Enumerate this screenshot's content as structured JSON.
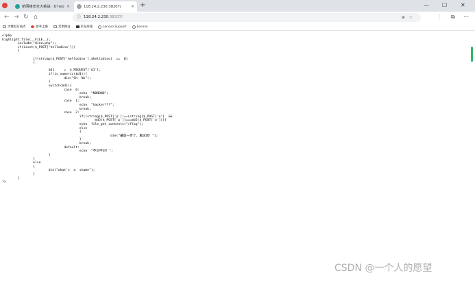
{
  "tabs": [
    {
      "label": "新网络安全大挑战 · D'neo CTF",
      "close": "×",
      "active": false,
      "favicon_color": "#1fa3a0"
    },
    {
      "label": "118.24.2.230:38207/",
      "close": "×",
      "active": true,
      "favicon_color": "#9aa0a6"
    }
  ],
  "new_tab": "+",
  "window_controls": {
    "minimize": "—",
    "maximize": "☐",
    "close": "✕"
  },
  "toolbar": {
    "back": "←",
    "forward": "→",
    "reload": "↻",
    "home": "⌂",
    "url_host": "118.24.2.230",
    "url_path": ":38207/",
    "omnibox_icons": "⊞☆",
    "split": "⫶",
    "extensions": "⧉",
    "menu": "⋯"
  },
  "bookmarks": [
    {
      "label": "大模拟方站点",
      "icon": "folder"
    },
    {
      "label": "新手上路",
      "icon": "red"
    },
    {
      "label": "常用网址",
      "icon": "folder"
    },
    {
      "label": "京东商城",
      "icon": "dark"
    },
    {
      "label": "Lenovo Support",
      "icon": "globe"
    },
    {
      "label": "Lenovo",
      "icon": "globe"
    }
  ],
  "code_lines": [
    "<?php",
    "highlight_file(__FILE__);",
    "        include(\"dino.php\");",
    "        if(isset($_POST['hellodino']))",
    "        {",
    "",
    "                if(strcmp($_POST['hellodino'],$hellodino)  ==  0)",
    "                {",
    "",
    "                        $d1     =  $_REQUEST['d1'];",
    "                        if(is_numeric($d1)){",
    "                                die(\"Oh  No\");",
    "                        }",
    "                        switch($d1){",
    "                                case  0:",
    "                                        echo  \"NONONO\";",
    "                                        break;",
    "                                case  1:",
    "                                        echo  \"hacker???\";",
    "                                        break;",
    "                                case  2:",
    "                                        if((string)$_POST['p']!==(string)$_POST['o']  &&",
    "                                                md5($_POST['p'])===md5($_POST['o'])){",
    "                                        echo  file_get_contents(\"/flag\");",
    "                                        else",
    "                                        {",
    "                                                        die(\"最后一步了，再试试！\");",
    "                                        }",
    "                                        break;",
    "                                default:",
    "                                        echo  \"不对不对！\";",
    "                        }",
    "                }",
    "                else",
    "                {",
    "                        die(\"what's  a  shame\");",
    "                }",
    "        }",
    "?>"
  ],
  "watermark": "CSDN @一个人的愿望",
  "colors": {
    "accent_scrollbar": "#2fb86a",
    "tab_bar": "#dfe3e8",
    "omnibox": "#f1f3f4"
  }
}
